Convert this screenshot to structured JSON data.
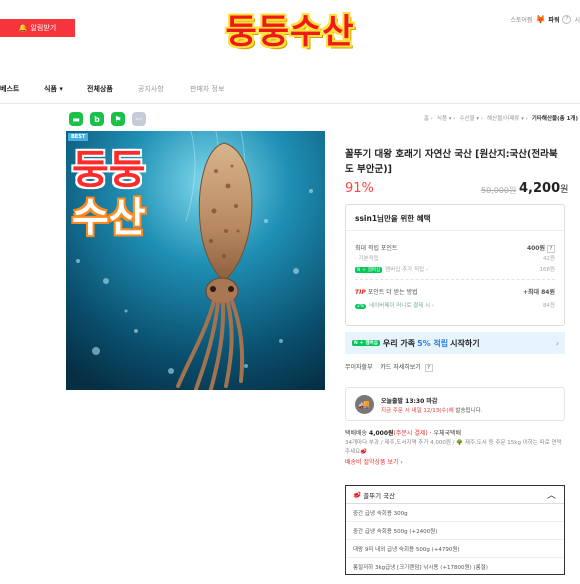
{
  "header": {
    "alarm_label": "알림받기",
    "store_name": "둥둥수산",
    "right_text": "스토어찜",
    "power_label": "파워",
    "right_badge": "?",
    "right_cut": "시"
  },
  "nav": {
    "items": [
      {
        "label": "베스트",
        "style": "bold"
      },
      {
        "label": "식품 ▾",
        "style": "bold"
      },
      {
        "label": "전체상품",
        "style": "bold"
      },
      {
        "label": "공지사항",
        "style": "muted"
      },
      {
        "label": "판매자 정보",
        "style": "muted"
      }
    ]
  },
  "share": {
    "icons": [
      "share-green-1",
      "share-green-2",
      "share-green-3",
      "more"
    ],
    "more_glyph": "···"
  },
  "breadcrumb": {
    "items": [
      "홈 ›",
      "식품 ▾ ›",
      "수산물 ▾ ›",
      "해산물/어패류 ▾ ›",
      "기타해산물(총 1개)"
    ]
  },
  "product": {
    "best_tag": "BEST",
    "image_text_1": "둥둥",
    "image_text_2": "수산",
    "title": "꼴뚜기 대왕 호래기 자연산 국산 [원산지:국산(전라북도 부안군)]",
    "discount": "91%",
    "original_price": "50,000원",
    "sale_price_num": "4,200",
    "sale_price_unit": "원"
  },
  "benefits": {
    "header": "ssin1님만을 위한 혜택",
    "max_points_label": "최대 적립 포인트",
    "max_points_value": "400원",
    "basic_label": "기본적립",
    "basic_value": "42원",
    "membership_label": "멤버십 추가 적립",
    "membership_value": "168원",
    "npay_tag": "N ＋ 멤버십",
    "tip_label": "TIP",
    "tip_text": "포인트 더 받는 방법",
    "tip_value": "+최대 84원",
    "money_pct": "2%",
    "money_label": "네이버페이 머니로 결제 시",
    "money_value": "84원"
  },
  "family_banner": {
    "tag": "N ＋ 멤버십",
    "text_before": "우리 가족",
    "highlight": "5% 적립",
    "text_after": "시작하기",
    "chevron": "›"
  },
  "payment": {
    "interest_free": "무이자할부",
    "card_detail": "카드 자세히보기",
    "help": "?"
  },
  "delivery": {
    "line1": "오늘출발 13:30 마감",
    "line2_red": "지금 주문 시 내일 12/13(수)에",
    "line2_rest": " 발송됩니다."
  },
  "shipping": {
    "label": "택배배송",
    "fee": "4,000원",
    "note": "(주문시 결제)",
    "carrier": "· 우체국택배",
    "extra": "34개마다 부과 / 제주,도서지역 추가 4,000원 / 🌳 제주,도서 등 주문 15kg 이하는 따로 연락주세요🥩",
    "link": "배송비 절약상품 보기 ›"
  },
  "options": {
    "header": "꼴뚜기 국산",
    "chevron": "︿",
    "items": [
      "중간 급냉 숙회용 300g",
      "중간 급냉 숙회용 500g (+2400원)",
      "대왕 9미 내외 급냉 숙회용 500g (+4790원)",
      "롱절저하 3kg급냉 [크기랜덤] 낚시용 (+17800원) (롱절)"
    ]
  },
  "colors": {
    "accent_red": "#f5353b",
    "price_red": "#ff4444",
    "naver_green": "#03c75a",
    "banner_blue": "#2a7ee8"
  }
}
